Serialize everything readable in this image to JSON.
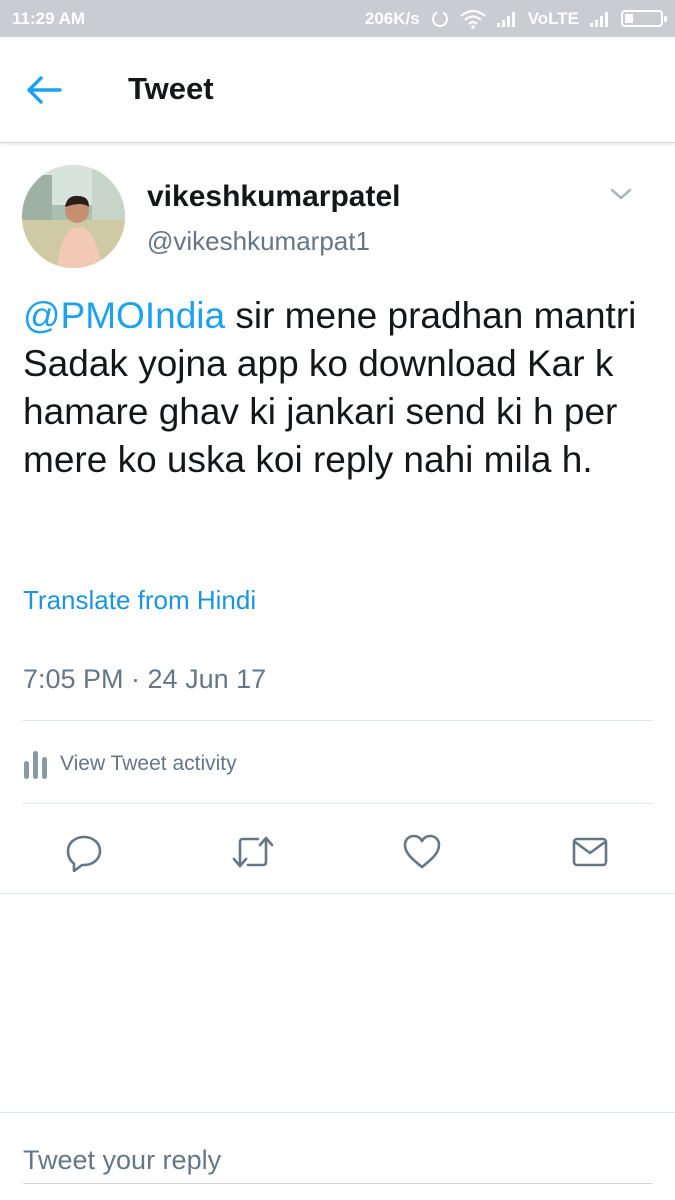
{
  "status_bar": {
    "time": "11:29 AM",
    "net_speed": "206K/s",
    "network": "VoLTE",
    "icons": [
      "loading-icon",
      "wifi-icon",
      "signal-icon",
      "signal-icon",
      "battery-icon"
    ]
  },
  "header": {
    "title": "Tweet",
    "back_icon": "back-arrow-icon"
  },
  "tweet": {
    "author_name": "vikeshkumarpatel",
    "author_handle": "@vikeshkumarpat1",
    "mention": "@PMOIndia",
    "text": " sir mene pradhan mantri Sadak yojna app ko download Kar k hamare ghav ki jankari send ki h per mere ko uska koi reply nahi mila h.",
    "translate_label": "Translate from Hindi",
    "timestamp": "7:05 PM · 24 Jun 17",
    "activity_label": "View Tweet activity"
  },
  "actions": [
    "reply-icon",
    "retweet-icon",
    "like-icon",
    "direct-message-icon"
  ],
  "reply": {
    "placeholder": "Tweet your reply"
  },
  "colors": {
    "accent": "#1da1f2",
    "link": "#1b95e0",
    "secondary_text": "#657786",
    "status_bar_bg": "#c9ccd0"
  }
}
